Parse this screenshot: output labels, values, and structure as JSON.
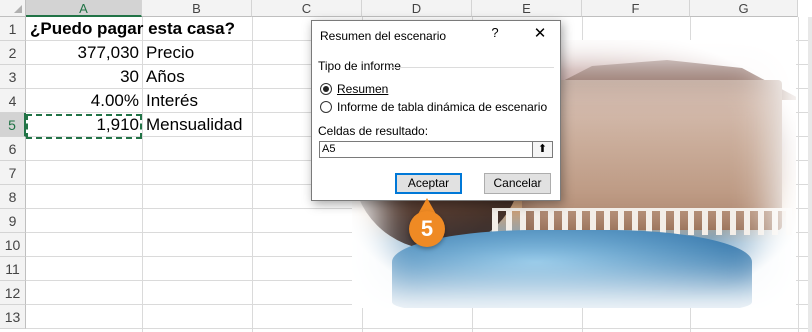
{
  "columns": [
    "A",
    "B",
    "C",
    "D",
    "E",
    "F",
    "G"
  ],
  "rows": [
    "1",
    "2",
    "3",
    "4",
    "5",
    "6",
    "7",
    "8",
    "9",
    "10",
    "11",
    "12",
    "13"
  ],
  "cells": {
    "a1b1": "¿Puedo pagar esta casa?",
    "a2": "377,030",
    "b2": "Precio",
    "a3": "30",
    "b3": "Años",
    "a4": "4.00%",
    "b4": "Interés",
    "a5": "1,910",
    "b5": "Mensualidad"
  },
  "selected_cell": "A5",
  "dialog": {
    "title": "Resumen del escenario",
    "help": "?",
    "close": "✕",
    "group_label": "Tipo de informe",
    "option1_label": "Resumen",
    "option2_label": "Informe de tabla dinámica de escenario",
    "selected_option": "Resumen",
    "field_label": "Celdas de resultado:",
    "field_value": "A5",
    "collapse_icon": "⬆",
    "ok_label": "Aceptar",
    "cancel_label": "Cancelar"
  },
  "step_badge": "5",
  "colors": {
    "accent_green": "#217346",
    "badge_orange": "#ef8a24",
    "button_focus": "#0078d7"
  }
}
